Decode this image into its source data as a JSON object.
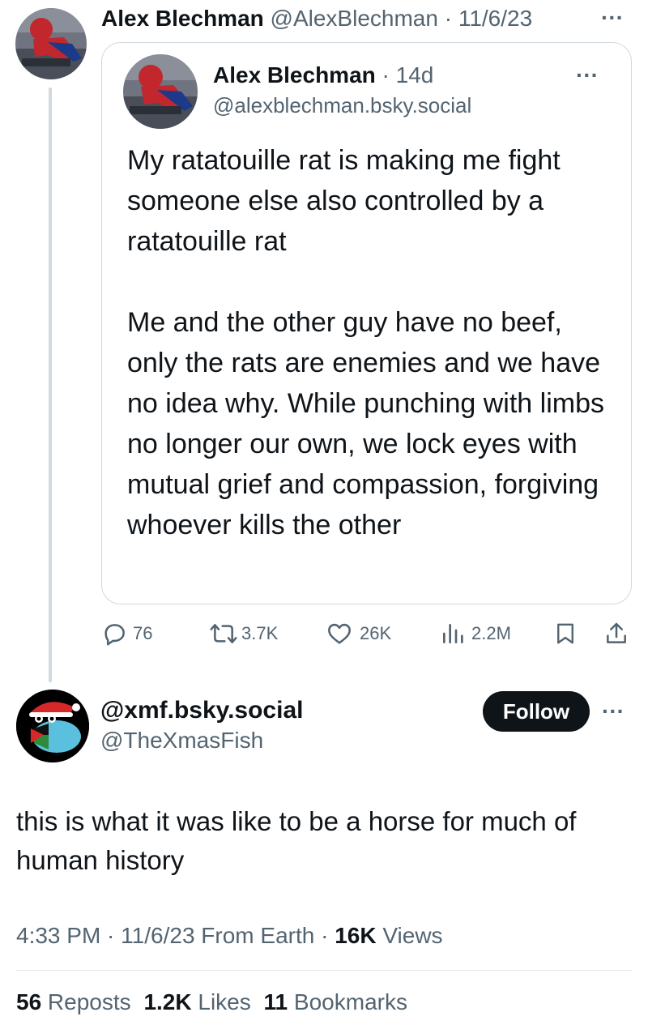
{
  "parent_tweet": {
    "author_name": "Alex Blechman",
    "author_handle": "@AlexBlechman",
    "separator": " · ",
    "date": "11/6/23",
    "more": "···"
  },
  "quoted_post": {
    "author_name": "Alex Blechman",
    "separator": "·",
    "age": "14d",
    "handle": "@alexblechman.bsky.social",
    "more": "···",
    "paragraph1": "My ratatouille rat is making me fight someone else also controlled by a ratatouille rat",
    "paragraph2": "Me and the other guy have no beef, only the rats are enemies and we have no idea why. While punching with limbs no longer our own, we lock eyes with mutual grief and compassion, forgiving whoever kills the other"
  },
  "actions": {
    "replies": "76",
    "reposts": "3.7K",
    "likes": "26K",
    "views": "2.2M",
    "icons": [
      "reply-icon",
      "repost-icon",
      "like-icon",
      "views-icon",
      "bookmark-icon",
      "share-icon"
    ]
  },
  "reply_tweet": {
    "author_name": "@xmf.bsky.social",
    "author_handle": "@TheXmasFish",
    "follow_label": "Follow",
    "more": "···",
    "text": "this is what it was like to be a horse for much of human history",
    "meta_time": "4:33 PM",
    "meta_sep1": " · ",
    "meta_date": "11/6/23 From Earth",
    "meta_sep2": " · ",
    "views_count": "16K",
    "views_label": " Views",
    "reposts_count": "56",
    "reposts_label": " Reposts",
    "likes_count": "1.2K",
    "likes_label": " Likes",
    "bookmarks_count": "11",
    "bookmarks_label": " Bookmarks"
  },
  "colors": {
    "text": "#0f1419",
    "secondary": "#536471",
    "border": "#cfd9de",
    "follow_bg": "#0f1419"
  }
}
